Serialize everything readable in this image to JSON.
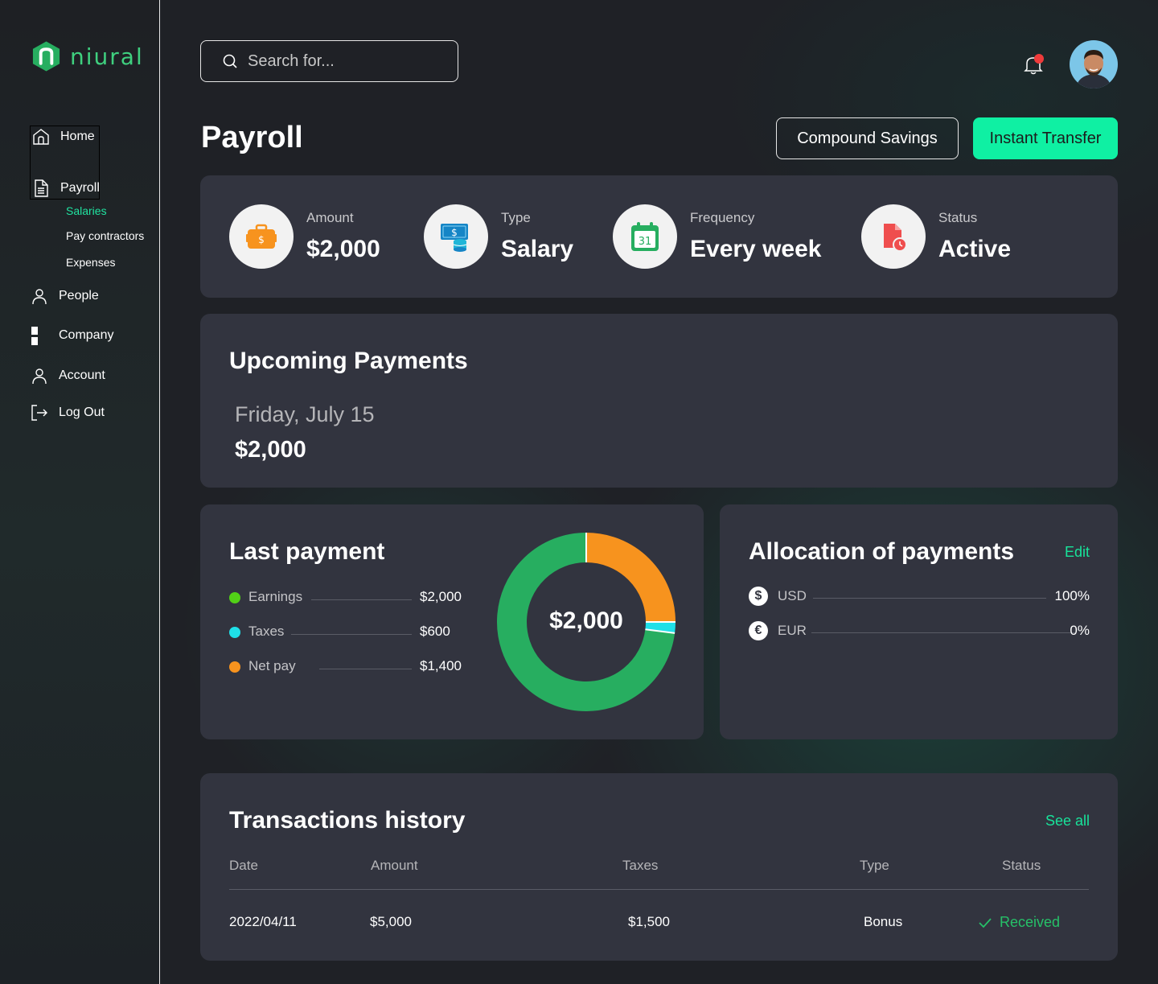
{
  "brand": {
    "name": "niural",
    "color": "#3fd07f"
  },
  "sidebar": {
    "items": [
      {
        "label": "Home",
        "icon": "home-icon"
      },
      {
        "label": "Payroll",
        "icon": "document-icon"
      },
      {
        "label": "People",
        "icon": "person-icon"
      },
      {
        "label": "Company",
        "icon": "building-icon"
      },
      {
        "label": "Account",
        "icon": "user-icon"
      },
      {
        "label": "Log Out",
        "icon": "logout-icon"
      }
    ],
    "payroll_subitems": [
      {
        "label": "Salaries",
        "active": true
      },
      {
        "label": "Pay contractors",
        "active": false
      },
      {
        "label": "Expenses",
        "active": false
      }
    ]
  },
  "search": {
    "placeholder": "Search for..."
  },
  "header": {
    "title": "Payroll",
    "secondary_button": "Compound Savings",
    "primary_button": "Instant Transfer",
    "primary_color": "#0ff0a3"
  },
  "summary": [
    {
      "label": "Amount",
      "value": "$2,000",
      "icon": "briefcase-money-icon"
    },
    {
      "label": "Type",
      "value": "Salary",
      "icon": "cash-coins-icon"
    },
    {
      "label": "Frequency",
      "value": "Every week",
      "icon": "calendar-icon",
      "calendar_day": "31"
    },
    {
      "label": "Status",
      "value": "Active",
      "icon": "document-clock-icon"
    }
  ],
  "upcoming": {
    "title": "Upcoming Payments",
    "date": "Friday, July 15",
    "amount": "$2,000"
  },
  "last_payment": {
    "title": "Last payment",
    "center_value": "$2,000",
    "items": [
      {
        "label": "Earnings",
        "value": "$2,000",
        "color": "#52d017"
      },
      {
        "label": "Taxes",
        "value": "$600",
        "color": "#1fe0e8"
      },
      {
        "label": "Net pay",
        "value": "$1,400",
        "color": "#f7931e"
      }
    ]
  },
  "chart_data": {
    "type": "pie",
    "categories": [
      "Net pay",
      "Taxes",
      "Earnings"
    ],
    "values": [
      0.25,
      0.02,
      0.73
    ],
    "colors": [
      "#f7931e",
      "#1fe0e8",
      "#27ae60"
    ],
    "title": ""
  },
  "allocation": {
    "title": "Allocation of payments",
    "edit_label": "Edit",
    "items": [
      {
        "symbol": "$",
        "currency": "USD",
        "value": "100%"
      },
      {
        "symbol": "€",
        "currency": "EUR",
        "value": "0%"
      }
    ]
  },
  "transactions": {
    "title": "Transactions history",
    "see_all_label": "See all",
    "columns": [
      "Date",
      "Amount",
      "Taxes",
      "Type",
      "Status"
    ],
    "rows": [
      {
        "date": "2022/04/11",
        "amount": "$5,000",
        "taxes": "$1,500",
        "type": "Bonus",
        "status": "Received"
      }
    ]
  }
}
